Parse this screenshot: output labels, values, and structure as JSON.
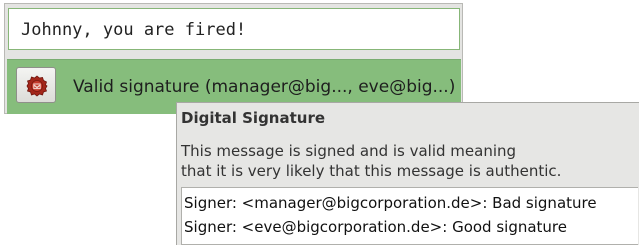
{
  "message": {
    "text": "Johnny, you are fired!"
  },
  "signature_bar": {
    "icon": "wax-seal-icon",
    "label": "Valid signature (manager@big..., eve@big...)",
    "color": "#86bd7c"
  },
  "tooltip": {
    "title": "Digital Signature",
    "description_lines": [
      "This message is signed and is valid meaning",
      "that it is very likely that this message is authentic."
    ],
    "signers": [
      "Signer: <manager@bigcorporation.de>: Bad signature",
      "Signer: <eve@bigcorporation.de>: Good signature"
    ]
  }
}
